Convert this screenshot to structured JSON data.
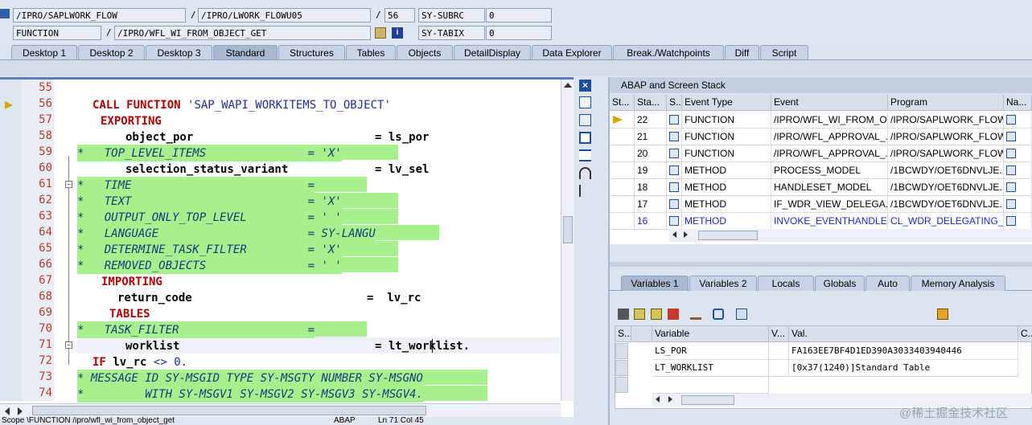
{
  "top": {
    "program": "/IPRO/SAPLWORK_FLOW",
    "include": "/IPRO/LWORK_FLOWU05",
    "line": "56",
    "subrc_label": "SY-SUBRC",
    "subrc_value": "0",
    "block_type": "FUNCTION",
    "block_name": "/IPRO/WFL_WI_FROM_OBJECT_GET",
    "tabix_label": "SY-TABIX",
    "tabix_value": "0",
    "slash": "/"
  },
  "tabs": [
    "Desktop 1",
    "Desktop 2",
    "Desktop 3",
    "Standard",
    "Structures",
    "Tables",
    "Objects",
    "DetailDisplay",
    "Data Explorer",
    "Break./Watchpoints",
    "Diff",
    "Script"
  ],
  "editor": {
    "lines": [
      "55",
      "56",
      "57",
      "58",
      "59",
      "60",
      "61",
      "62",
      "63",
      "64",
      "65",
      "66",
      "67",
      "68",
      "69",
      "70",
      "71",
      "72",
      "73",
      "74"
    ],
    "code": {
      "l56_kw": "CALL FUNCTION",
      "l56_str": "'SAP_WAPI_WORKITEMS_TO_OBJECT'",
      "l57": "EXPORTING",
      "l58_a": "object_por",
      "l58_b": "= ls_por",
      "l59": "*   TOP_LEVEL_ITEMS               = 'X'",
      "l60_a": "selection_status_variant",
      "l60_b": "= lv_sel",
      "l61": "*   TIME                          =",
      "l62": "*   TEXT                          = 'X'",
      "l63": "*   OUTPUT_ONLY_TOP_LEVEL         = ' '",
      "l64": "*   LANGUAGE                      = SY-LANGU",
      "l65": "*   DETERMINE_TASK_FILTER         = 'X'",
      "l66": "*   REMOVED_OBJECTS               = ' '",
      "l67": "IMPORTING",
      "l68_a": "return_code",
      "l68_b": "=  lv_rc",
      "l69": "TABLES",
      "l70": "*   TASK_FILTER                   =",
      "l71_a": "worklist",
      "l71_b": "= lt_worklist.",
      "l72_kw": "IF",
      "l72_rest": "lv_rc",
      "l72_op": "<>",
      "l72_num": "0.",
      "l73": "* MESSAGE ID SY-MSGID TYPE SY-MSGTY NUMBER SY-MSGNO",
      "l74": "*         WITH SY-MSGV1 SY-MSGV2 SY-MSGV3 SY-MSGV4."
    },
    "status": "Scope \\FUNCTION /ipro/wfl_wi_from_object_get",
    "status_lang": "ABAP",
    "status_pos": "Ln  71 Col  45"
  },
  "stack": {
    "title": "ABAP and Screen Stack",
    "headers": [
      "St...",
      "Sta...",
      "S...",
      "Event Type",
      "Event",
      "Program",
      "Na..."
    ],
    "rows": [
      {
        "level": "22",
        "type": "FUNCTION",
        "event": "/IPRO/WFL_WI_FROM_O...",
        "program": "/IPRO/SAPLWORK_FLOW"
      },
      {
        "level": "21",
        "type": "FUNCTION",
        "event": "/IPRO/WFL_APPROVAL_...",
        "program": "/IPRO/SAPLWORK_FLOW"
      },
      {
        "level": "20",
        "type": "FUNCTION",
        "event": "/IPRO/WFL_APPROVAL_...",
        "program": "/IPRO/SAPLWORK_FLOW"
      },
      {
        "level": "19",
        "type": "METHOD",
        "event": "PROCESS_MODEL",
        "program": "/1BCWDY/OET6DNVLJE..."
      },
      {
        "level": "18",
        "type": "METHOD",
        "event": "HANDLESET_MODEL",
        "program": "/1BCWDY/OET6DNVLJE..."
      },
      {
        "level": "17",
        "type": "METHOD",
        "event": "IF_WDR_VIEW_DELEGA...",
        "program": "/1BCWDY/OET6DNVLJE..."
      },
      {
        "level": "16",
        "type": "METHOD",
        "event": "INVOKE_EVENTHANDLER",
        "program": "CL_WDR_DELEGATING_..."
      }
    ]
  },
  "var_tabs": [
    "Variables 1",
    "Variables 2",
    "Locals",
    "Globals",
    "Auto",
    "Memory Analysis"
  ],
  "vars": {
    "headers": [
      "S...",
      "Variable",
      "V...",
      "Val.",
      "C..."
    ],
    "rows": [
      {
        "name": "LS_POR",
        "value": "FA163EE7BF4D1ED390A3033403940446"
      },
      {
        "name": "LT_WORKLIST",
        "value": "[0x37(1240)]Standard Table"
      }
    ]
  },
  "watermark": "@稀土掘金技术社区"
}
